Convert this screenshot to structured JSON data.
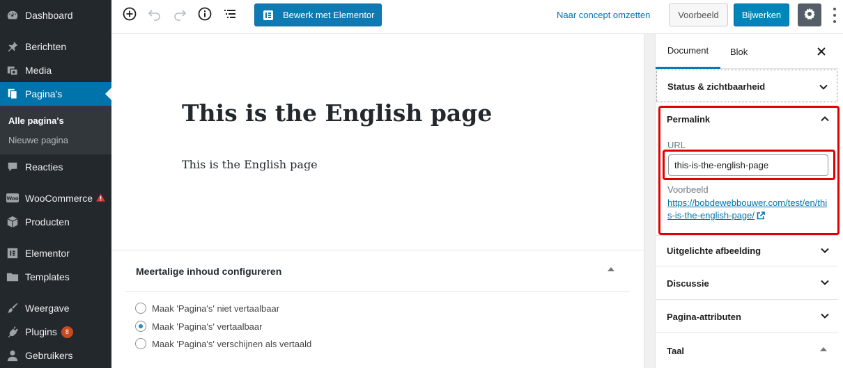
{
  "admin_menu": {
    "items": [
      {
        "label": "Dashboard",
        "icon": "dashboard-icon"
      },
      {
        "label": "Berichten",
        "icon": "pin-icon"
      },
      {
        "label": "Media",
        "icon": "media-icon"
      },
      {
        "label": "Pagina's",
        "icon": "pages-icon"
      },
      {
        "label": "Reacties",
        "icon": "comments-icon"
      },
      {
        "label": "WooCommerce",
        "icon": "woocommerce-icon"
      },
      {
        "label": "Producten",
        "icon": "box-icon"
      },
      {
        "label": "Elementor",
        "icon": "elementor-icon"
      },
      {
        "label": "Templates",
        "icon": "folder-icon"
      },
      {
        "label": "Weergave",
        "icon": "brush-icon"
      },
      {
        "label": "Plugins",
        "icon": "plugin-icon"
      },
      {
        "label": "Gebruikers",
        "icon": "users-icon"
      }
    ],
    "submenu": [
      "Alle pagina's",
      "Nieuwe pagina"
    ],
    "plugins_badge": "8",
    "colors": {
      "bg": "#23282d",
      "active": "#0073aa"
    }
  },
  "toolbar": {
    "elementor_label": "Bewerk met Elementor",
    "draft_label": "Naar concept omzetten",
    "preview_label": "Voorbeeld",
    "update_label": "Bijwerken"
  },
  "editor": {
    "title": "This is the English page",
    "paragraph": "This is the English page",
    "meta_box": {
      "title": "Meertalige inhoud configureren",
      "options": [
        {
          "label": "Maak 'Pagina's' niet vertaalbaar",
          "checked": false
        },
        {
          "label": "Maak 'Pagina's' vertaalbaar",
          "checked": true
        },
        {
          "label": "Maak 'Pagina's' verschijnen als vertaald",
          "checked": false
        }
      ]
    }
  },
  "sidebar": {
    "tabs": [
      "Document",
      "Blok"
    ],
    "panels": {
      "status": "Status & zichtbaarheid",
      "permalink": "Permalink",
      "featured": "Uitgelichte afbeelding",
      "discussion": "Discussie",
      "attributes": "Pagina-attributen",
      "language": "Taal"
    },
    "permalink": {
      "url_label": "URL",
      "slug": "this-is-the-english-page",
      "preview_label": "Voorbeeld",
      "preview_url": "https://bobdewebbouwer.com/test/en/this-is-the-english-page/"
    }
  }
}
